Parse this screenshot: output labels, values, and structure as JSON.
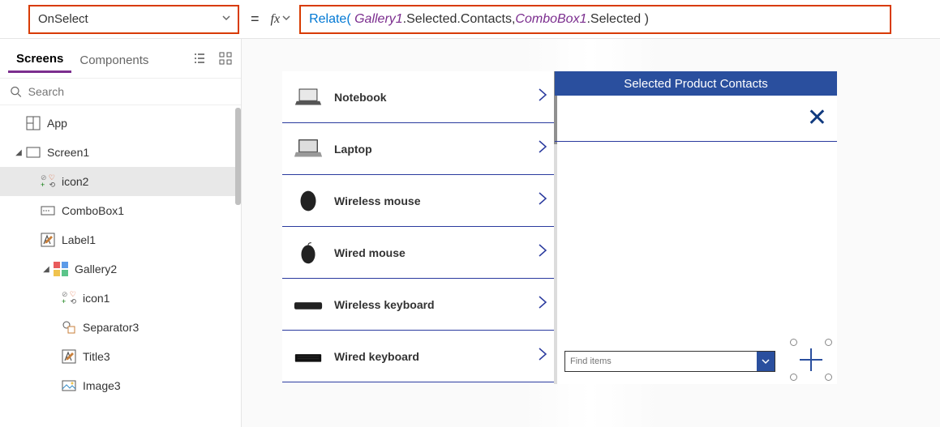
{
  "formula_bar": {
    "property": "OnSelect",
    "formula": {
      "fn": "Relate",
      "obj1": "Gallery1",
      "path1": ".Selected.Contacts, ",
      "obj2": "ComboBox1",
      "path2": ".Selected )"
    }
  },
  "tabs": {
    "screens": "Screens",
    "components": "Components"
  },
  "search_placeholder": "Search",
  "tree": {
    "app": "App",
    "screen1": "Screen1",
    "icon2": "icon2",
    "combobox1": "ComboBox1",
    "label1": "Label1",
    "gallery2": "Gallery2",
    "icon1": "icon1",
    "separator3": "Separator3",
    "title3": "Title3",
    "image3": "Image3"
  },
  "gallery_items": [
    "Notebook",
    "Laptop",
    "Wireless mouse",
    "Wired mouse",
    "Wireless keyboard",
    "Wired keyboard"
  ],
  "contacts": {
    "header": "Selected Product Contacts",
    "combo_placeholder": "Find items"
  }
}
